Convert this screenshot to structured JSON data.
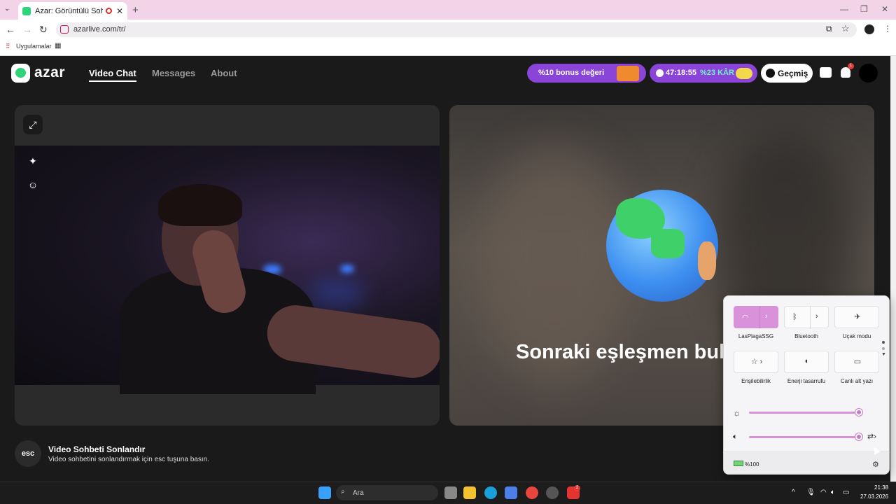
{
  "browser": {
    "tab_title": "Azar: Görüntülü Sohbet & V",
    "tab_close": "✕",
    "new_tab": "+",
    "url": "azarlive.com/tr/",
    "bookmarks_label": "Uygulamalar"
  },
  "site": {
    "logo": "azar",
    "nav": [
      {
        "label": "Video Chat"
      },
      {
        "label": "Messages"
      },
      {
        "label": "About"
      }
    ],
    "bonus_text": "%10 bonus değeri",
    "timer_text": "47:18:55",
    "kar_text": "%23 KÂR",
    "history_label": "Geçmiş",
    "notification_count": "1",
    "find_text": "Sonraki eşleşmen bul",
    "esc": {
      "badge": "esc",
      "title": "Video Sohbeti Sonlandır",
      "desc": "Video sohbetini sonlandırmak için esc tuşuna basın."
    }
  },
  "quick_settings": {
    "tiles": [
      {
        "label": "LasPlagaSSG",
        "icon": "wifi-icon",
        "on": true
      },
      {
        "label": "Bluetooth",
        "icon": "bluetooth-icon",
        "on": false
      },
      {
        "label": "Uçak modu",
        "icon": "airplane-icon",
        "on": false
      },
      {
        "label": "Erişilebilirlik",
        "icon": "accessibility-icon",
        "on": false
      },
      {
        "label": "Enerji tasarrufu",
        "icon": "energy-saver-icon",
        "on": false
      },
      {
        "label": "Canlı alt yazı",
        "icon": "live-captions-icon",
        "on": false
      }
    ],
    "brightness": 1.0,
    "volume": 1.0,
    "battery_label": "%100"
  },
  "taskbar": {
    "search_placeholder": "Ara",
    "time": "21:38",
    "date": "27.03.2026",
    "badge_count": "2"
  },
  "colors": {
    "accent_purple": "#8a45d8",
    "qs_accent": "#d991d9",
    "azar_green": "#2fd37a"
  }
}
